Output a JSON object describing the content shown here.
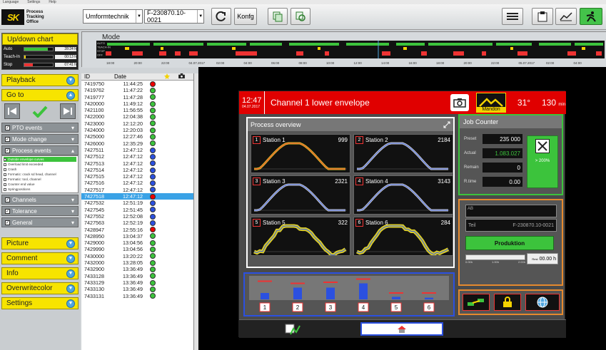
{
  "menubar": {
    "items": [
      "Language",
      "Settings",
      "Help"
    ]
  },
  "app": {
    "logo_mark": "SK",
    "brand": "schwer + kopka",
    "title_line1": "Process",
    "title_line2": "Tracking",
    "title_line3": "Office"
  },
  "toolbar": {
    "machine": "Umformtechnik",
    "part": "F-230870.10-0021",
    "config_label": "Konfg"
  },
  "leftpanel": {
    "updown_title": "Up/down chart",
    "stats": [
      {
        "label": "Auto",
        "value": "28:24 h",
        "fill": 0.82
      },
      {
        "label": "Teach-In",
        "value": "00:13 h",
        "fill": 0.05
      },
      {
        "label": "Stop",
        "value": "07:41 h",
        "fill": 0.3
      }
    ],
    "playback": "Playback",
    "goto": "Go to",
    "groups": [
      {
        "label": "PTO events",
        "checked": true
      },
      {
        "label": "Mode change",
        "checked": true
      },
      {
        "label": "Process events",
        "checked": true
      }
    ],
    "process_events": [
      "Outside envelope curves",
      "Overload limit exceeded",
      "Crash",
      "Formatic: crack sd head, channel",
      "Formatic: tool, channel",
      "Counter end value",
      "Springpositions"
    ],
    "groups2": [
      {
        "label": "Channels",
        "checked": true
      },
      {
        "label": "Tolerance",
        "checked": true
      },
      {
        "label": "General",
        "checked": true
      }
    ],
    "buttons": [
      "Picture",
      "Comment",
      "Info",
      "Overwritecolor",
      "Settings"
    ]
  },
  "modechart": {
    "title": "Mode",
    "legend": [
      "AUTO",
      "TEACH-IN",
      "STOP",
      "OFF"
    ],
    "times": [
      "18:00",
      "20:00",
      "22:00",
      "04.07.2017",
      "02:00",
      "04:00",
      "06:00",
      "08:00",
      "10:00",
      "12:00",
      "14:00",
      "16:00",
      "18:00",
      "20:00",
      "22:00",
      "05.07.2017",
      "02:00",
      "04:00"
    ]
  },
  "table": {
    "col_id": "ID",
    "col_date": "Date",
    "rows": [
      {
        "id": "7419750",
        "time": "11:44:25",
        "status": "red"
      },
      {
        "id": "7419762",
        "time": "11:47:22",
        "status": "green"
      },
      {
        "id": "7419777",
        "time": "11:47:28",
        "status": "green"
      },
      {
        "id": "7420000",
        "time": "11:49:12",
        "status": "green"
      },
      {
        "id": "7421100",
        "time": "11:56:55",
        "status": "green"
      },
      {
        "id": "7422000",
        "time": "12:04:38",
        "status": "green"
      },
      {
        "id": "7423000",
        "time": "12:12:20",
        "status": "green"
      },
      {
        "id": "7424000",
        "time": "12:20:03",
        "status": "green"
      },
      {
        "id": "7425000",
        "time": "12:27:46",
        "status": "green"
      },
      {
        "id": "7426000",
        "time": "12:35:29",
        "status": "green"
      },
      {
        "id": "7427511",
        "time": "12:47:12",
        "status": "blue"
      },
      {
        "id": "7427512",
        "time": "12:47:12",
        "status": "blue"
      },
      {
        "id": "7427513",
        "time": "12:47:12",
        "status": "blue"
      },
      {
        "id": "7427514",
        "time": "12:47:12",
        "status": "blue"
      },
      {
        "id": "7427515",
        "time": "12:47:12",
        "status": "blue"
      },
      {
        "id": "7427516",
        "time": "12:47:12",
        "status": "blue"
      },
      {
        "id": "7427517",
        "time": "12:47:12",
        "status": "blue"
      },
      {
        "id": "7427518",
        "time": "12:47:12",
        "status": "red",
        "selected": true
      },
      {
        "id": "7427532",
        "time": "12:51:19",
        "status": "blue"
      },
      {
        "id": "7427545",
        "time": "12:51:45",
        "status": "blue"
      },
      {
        "id": "7427552",
        "time": "12:52:08",
        "status": "blue"
      },
      {
        "id": "7427563",
        "time": "12:52:19",
        "status": "blue"
      },
      {
        "id": "7428947",
        "time": "12:55:16",
        "status": "red"
      },
      {
        "id": "7428950",
        "time": "13:04:37",
        "status": "green"
      },
      {
        "id": "7429000",
        "time": "13:04:56",
        "status": "green"
      },
      {
        "id": "7429990",
        "time": "13:04:56",
        "status": "green"
      },
      {
        "id": "7430000",
        "time": "13:20:22",
        "status": "green"
      },
      {
        "id": "7432000",
        "time": "13:28:05",
        "status": "green"
      },
      {
        "id": "7432900",
        "time": "13:36:49",
        "status": "green"
      },
      {
        "id": "7433128",
        "time": "13:36:49",
        "status": "green"
      },
      {
        "id": "7433129",
        "time": "13:36:49",
        "status": "green"
      },
      {
        "id": "7433130",
        "time": "13:36:49",
        "status": "green"
      },
      {
        "id": "7433131",
        "time": "13:36:49",
        "status": "green"
      }
    ]
  },
  "hmi": {
    "time": "12:47",
    "date": "04.07.2017",
    "title": "Channel 1 lower envelope",
    "brand": "Mandon",
    "temp": "31°",
    "speed": "130",
    "speed_unit": "min",
    "process_title": "Process overview",
    "stations": [
      {
        "n": "1",
        "name": "Station 1",
        "value": "999",
        "color": "#f2e12a"
      },
      {
        "n": "2",
        "name": "Station 2",
        "value": "2184",
        "color": "#e8e8e8"
      },
      {
        "n": "3",
        "name": "Station 3",
        "value": "2321",
        "color": "#e8e8e8"
      },
      {
        "n": "4",
        "name": "Station 4",
        "value": "3143",
        "color": "#e8e8e8"
      },
      {
        "n": "5",
        "name": "Station 5",
        "value": "322",
        "color": "#f2e12a"
      },
      {
        "n": "6",
        "name": "Station 6",
        "value": "284",
        "color": "#f2e12a"
      }
    ],
    "job": {
      "title": "Job Counter",
      "rows": [
        {
          "label": "Preset",
          "value": "235 000"
        },
        {
          "label": "Actual",
          "value": "1.083.027"
        },
        {
          "label": "Remain",
          "value": "0"
        },
        {
          "label": "R.time",
          "value": "0.00"
        }
      ],
      "pct": "> 200%"
    },
    "order": {
      "label1": "AB",
      "label2": "Teil",
      "part": "F-230870.10-0021",
      "button": "Produktion",
      "ticks": [
        "0.00h",
        "1.00h",
        "2.00h"
      ],
      "time_label": "Rest",
      "time": "00.00 h"
    },
    "bars": [
      {
        "n": "1",
        "level": 0.3,
        "limit": 0.85
      },
      {
        "n": "2",
        "level": 0.55,
        "limit": 0.75
      },
      {
        "n": "3",
        "level": 0.55,
        "limit": 0.8
      },
      {
        "n": "4",
        "level": 0.75,
        "limit": 0.95
      },
      {
        "n": "5",
        "level": 0.12,
        "limit": 0.3
      },
      {
        "n": "6",
        "level": 0.08,
        "limit": 0.3
      }
    ]
  }
}
